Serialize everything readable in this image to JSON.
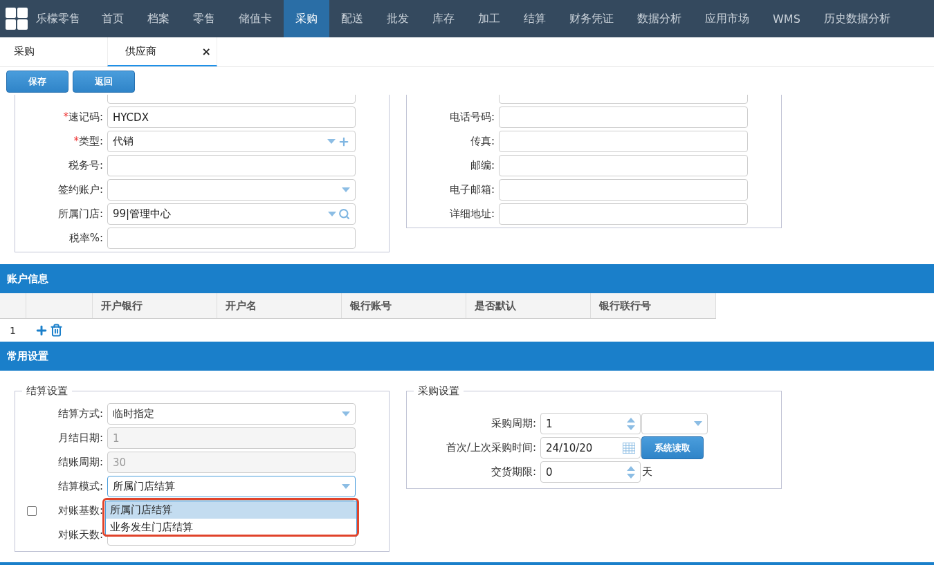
{
  "nav": {
    "brand": "乐檬零售",
    "items": [
      {
        "label": "首页",
        "selected": false
      },
      {
        "label": "档案",
        "selected": false
      },
      {
        "label": "零售",
        "selected": false
      },
      {
        "label": "储值卡",
        "selected": false
      },
      {
        "label": "采购",
        "selected": true
      },
      {
        "label": "配送",
        "selected": false
      },
      {
        "label": "批发",
        "selected": false
      },
      {
        "label": "库存",
        "selected": false
      },
      {
        "label": "加工",
        "selected": false
      },
      {
        "label": "结算",
        "selected": false
      },
      {
        "label": "财务凭证",
        "selected": false
      },
      {
        "label": "数据分析",
        "selected": false
      },
      {
        "label": "应用市场",
        "selected": false
      },
      {
        "label": "WMS",
        "selected": false
      },
      {
        "label": "历史数据分析",
        "selected": false
      }
    ]
  },
  "tabs": [
    {
      "label": "采购",
      "selected": false
    },
    {
      "label": "供应商",
      "selected": true,
      "close": "×"
    }
  ],
  "toolbar": [
    "保存",
    "返回"
  ],
  "basic_left": [
    {
      "label": "速记码:",
      "required_mark": "*",
      "value": "HYCDX",
      "kind": "text"
    },
    {
      "label": "类型:",
      "required_mark": "*",
      "value": "代销",
      "kind": "select_add"
    },
    {
      "label": "税务号:",
      "kind": "text"
    },
    {
      "label": "签约账户:",
      "kind": "select"
    },
    {
      "label": "所属门店:",
      "value": "99|管理中心",
      "kind": "select_search"
    },
    {
      "label": "税率%:",
      "kind": "text"
    }
  ],
  "basic_right": [
    {
      "label": "电话号码:"
    },
    {
      "label": "传真:"
    },
    {
      "label": "邮编:"
    },
    {
      "label": "电子邮箱:"
    },
    {
      "label": "详细地址:"
    }
  ],
  "account": {
    "title": "账户信息",
    "columns": [
      "开户银行",
      "开户名",
      "银行账号",
      "是否默认",
      "银行联行号"
    ],
    "row_number": "1"
  },
  "settings": {
    "title": "常用设置",
    "settlement": {
      "legend": "结算设置",
      "fields": [
        {
          "label": "结算方式:",
          "value": "临时指定",
          "kind": "select",
          "disabled": false
        },
        {
          "label": "月结日期:",
          "value": "1",
          "kind": "text",
          "disabled": true
        },
        {
          "label": "结账周期:",
          "value": "30",
          "kind": "text",
          "disabled": true
        },
        {
          "label": "结算模式:",
          "value": "所属门店结算",
          "kind": "select",
          "disabled": false,
          "open": true
        },
        {
          "label": "对账基数:",
          "kind": "text",
          "checkbox": false
        },
        {
          "label": "对账天数:",
          "kind": "text"
        }
      ],
      "dropdown": [
        {
          "label": "所属门店结算",
          "selected": true
        },
        {
          "label": "业务发生门店结算",
          "selected": false
        }
      ]
    },
    "purchase": {
      "legend": "采购设置",
      "fields": [
        {
          "label": "采购周期:",
          "value": "1",
          "kind": "spinner_select"
        },
        {
          "label": "首次/上次采购时间:",
          "value": "24/10/20",
          "kind": "date",
          "button": "系统读取"
        },
        {
          "label": "交货期限:",
          "value": "0",
          "kind": "spinner",
          "unit": "天"
        }
      ]
    }
  }
}
